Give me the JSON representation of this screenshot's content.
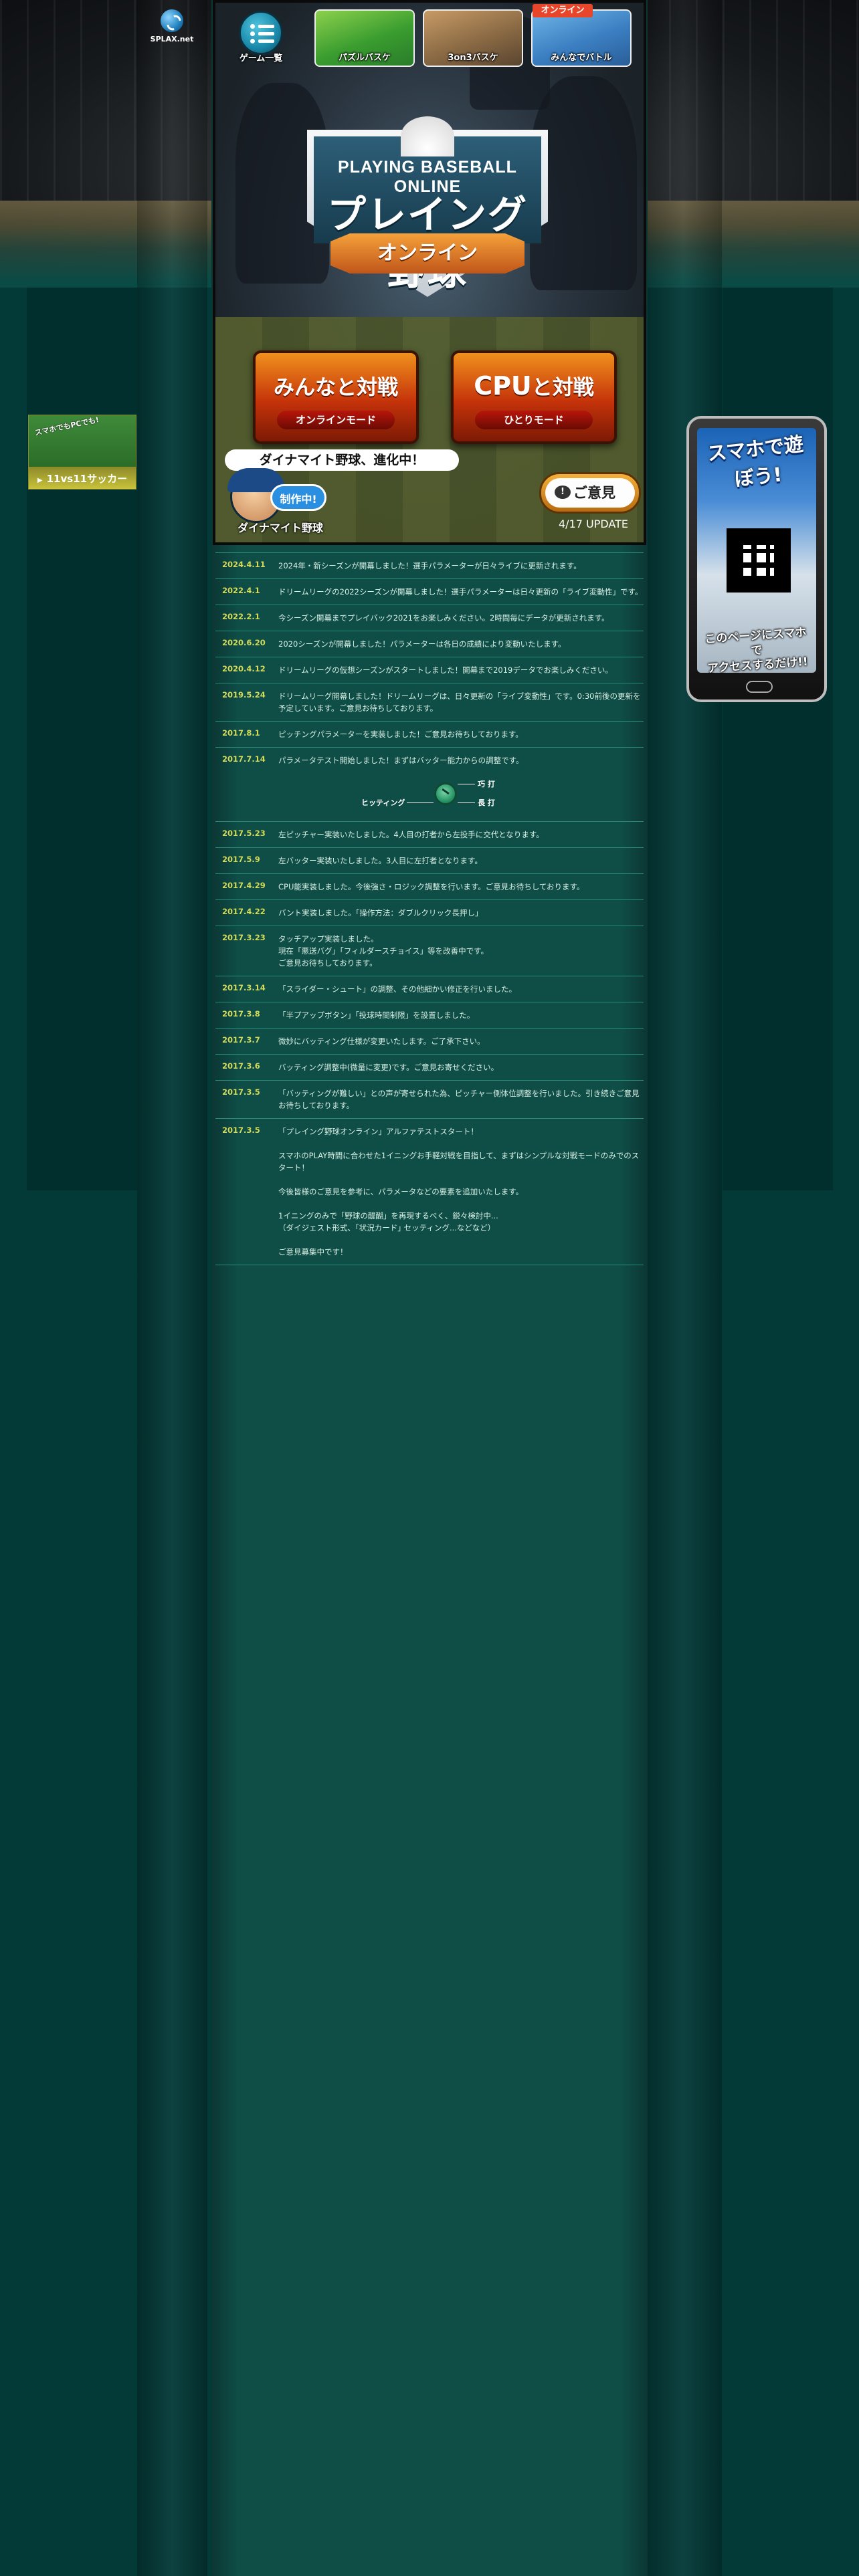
{
  "site": {
    "logo_label": "SPLAX.net"
  },
  "nav": {
    "menu_label": "ゲーム一覧",
    "thumbs": [
      {
        "label": "パズルバスケ"
      },
      {
        "label": "3on3バスケ"
      },
      {
        "label": "みんなでバトル",
        "tag": "オンライン"
      }
    ]
  },
  "logo": {
    "english": "PLAYING BASEBALL ONLINE",
    "japanese": "プレイング野球",
    "ribbon": "オンライン"
  },
  "modes": [
    {
      "title_small": "みんなと対戦",
      "sub": "オンラインモード"
    },
    {
      "title_small": "と対戦",
      "title_big": "CPU",
      "sub": "ひとりモード"
    }
  ],
  "dynamite": {
    "bubble": "ダイナマイト野球、進化中！",
    "badge": "制作中!",
    "title": "ダイナマイト野球"
  },
  "feedback": {
    "label": "ご意見",
    "icon": "!",
    "update": "4/17 UPDATE"
  },
  "news": [
    {
      "date": "2024.4.11",
      "text": [
        "2024年・新シーズンが開幕しました！選手パラメーターが日々ライブに更新されます。"
      ]
    },
    {
      "date": "2022.4.1",
      "text": [
        "ドリームリーグの2022シーズンが開幕しました！選手パラメーターは日々更新の「ライブ変動性」です。"
      ]
    },
    {
      "date": "2022.2.1",
      "text": [
        "今シーズン開幕までプレイバック2021をお楽しみください。2時間毎にデータが更新されます。"
      ]
    },
    {
      "date": "2020.6.20",
      "text": [
        "2020シーズンが開幕しました！パラメーターは各日の成績により変動いたします。"
      ]
    },
    {
      "date": "2020.4.12",
      "text": [
        "ドリームリーグの仮想シーズンがスタートしました！開幕まで2019データでお楽しみください。"
      ]
    },
    {
      "date": "2019.5.24",
      "text": [
        "ドリームリーグ開幕しました！ドリームリーグは、日々更新の「ライブ変動性」です。0:30前後の更新を予定しています。ご意見お待ちしております。"
      ]
    },
    {
      "date": "2017.8.1",
      "text": [
        "ピッチングパラメーターを実装しました！ご意見お待ちしております。"
      ]
    },
    {
      "date": "2017.7.14",
      "text": [
        "パラメータテスト開始しました！まずはバッター能力からの調整です。"
      ],
      "diagram": {
        "label": "ヒッティング",
        "top": "巧 打",
        "bottom": "長 打"
      }
    },
    {
      "date": "2017.5.23",
      "text": [
        "左ピッチャー実装いたしました。4人目の打者から左投手に交代となります。"
      ]
    },
    {
      "date": "2017.5.9",
      "text": [
        "左バッター実装いたしました。3人目に左打者となります。"
      ]
    },
    {
      "date": "2017.4.29",
      "text": [
        "CPU能実装しました。今後強さ・ロジック調整を行います。ご意見お待ちしております。"
      ]
    },
    {
      "date": "2017.4.22",
      "text": [
        "バント実装しました。「操作方法：ダブルクリック長押し」"
      ]
    },
    {
      "date": "2017.3.23",
      "text": [
        "タッチアップ実装しました。",
        "現在「悪送バグ」「フィルダースチョイス」等を改善中です。",
        "ご意見お待ちしております。"
      ]
    },
    {
      "date": "2017.3.14",
      "text": [
        "「スライダー・シュート」の調整、その他細かい修正を行いました。"
      ]
    },
    {
      "date": "2017.3.8",
      "text": [
        "「半プアップボタン」「投球時間制限」を設置しました。"
      ]
    },
    {
      "date": "2017.3.7",
      "text": [
        "微妙にバッティング仕様が変更いたします。ご了承下さい。"
      ]
    },
    {
      "date": "2017.3.6",
      "text": [
        "バッティング調整中(微量に変更)です。ご意見お寄せください。"
      ]
    },
    {
      "date": "2017.3.5",
      "text": [
        "「バッティングが難しい」との声が寄せられた為、ピッチャー側体位調整を行いました。引き続きご意見お待ちしております。"
      ]
    },
    {
      "date": "2017.3.5",
      "text": [
        "「プレイング野球オンライン」アルファテストスタート！",
        "",
        "スマホのPLAY時間に合わせた1イニングお手軽対戦を目指して、まずはシンプルな対戦モードのみでのスタート！",
        "",
        "今後皆様のご意見を参考に、パラメータなどの要素を追加いたします。",
        "",
        "1イニングのみで「野球の醍醐」を再現するべく、鋭々検討中...",
        "（ダイジェスト形式、｢状況カード｣ セッティング...などなど）",
        "",
        "ご意見募集中です！"
      ]
    }
  ],
  "side_banners": {
    "soccer": {
      "tag": "スマホでもPCでも!",
      "label": "11vs11サッカー"
    },
    "phone": {
      "title": "スマホで遊ぼう!",
      "caption": [
        "このページにスマホで",
        "アクセスするだけ!!"
      ]
    }
  }
}
